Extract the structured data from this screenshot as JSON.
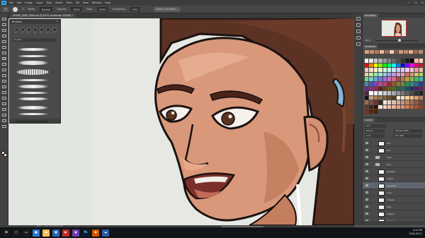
{
  "app": {
    "logo_text": "Ps",
    "menu": [
      "File",
      "Edit",
      "Image",
      "Layer",
      "Type",
      "Select",
      "Filter",
      "3D",
      "View",
      "Window",
      "Help"
    ],
    "window_controls": [
      "—",
      "☐",
      "✕"
    ]
  },
  "options": {
    "tool_preset": "B",
    "brush_size": "5",
    "mode_label": "Mode:",
    "mode_value": "Normal",
    "opacity_label": "Opacity:",
    "opacity_value": "100%",
    "flow_label": "Flow:",
    "flow_value": "100%",
    "smoothing_label": "Smoothing:",
    "smoothing_value": "10%",
    "select_mask_btn": "Select and Mask..."
  },
  "document": {
    "tab_title": "ZHURE_SHAE_SKIN.psd @ 200% (eyebrows, RGB/8) *"
  },
  "brushes_panel": {
    "title": "Brushes",
    "close": "»",
    "search_placeholder": "Brushes",
    "preset_sizes": [
      "10",
      "20",
      "30",
      "40",
      "50",
      "60",
      "70"
    ]
  },
  "navigator": {
    "tab": "Navigator",
    "zoom": "200%"
  },
  "swatches": {
    "tab": "Swatches",
    "recent": [
      "#d9a37f",
      "#c98e6b",
      "#b77a59",
      "#e8bfa0",
      "#a26b50",
      "#f0d2bb",
      "#8e5a43",
      "#d39b77",
      "#bf8866",
      "#e3b191",
      "#9e6a52",
      "#c58c6b"
    ],
    "palette": [
      "#ffffff",
      "#e6e6e6",
      "#cccccc",
      "#b3b3b3",
      "#999999",
      "#808080",
      "#666666",
      "#4d4d4d",
      "#333333",
      "#1a1a1a",
      "#000000",
      "#ffb3b3",
      "#ffd9b3",
      "#ff0000",
      "#ff8000",
      "#ffff00",
      "#80ff00",
      "#00ff00",
      "#00ff80",
      "#00ffff",
      "#0080ff",
      "#0000ff",
      "#8000ff",
      "#ff00ff",
      "#ff0080",
      "#c02020",
      "#f7c7c7",
      "#f7dbc7",
      "#f7f0c7",
      "#dcf7c7",
      "#c7f7d7",
      "#c7f7f0",
      "#c7e2f7",
      "#c7cdf7",
      "#dcc7f7",
      "#f7c7ed",
      "#f7c7d6",
      "#e89b9b",
      "#e8bd9b",
      "#e8d59b",
      "#c6e89b",
      "#9be8b3",
      "#9be8dc",
      "#9bc6e8",
      "#9ba6e8",
      "#c19be8",
      "#e89bd5",
      "#e89bb3",
      "#d66a6a",
      "#d6996a",
      "#d6bf6a",
      "#a9d66a",
      "#6ad68d",
      "#6ad6c4",
      "#6aa9d6",
      "#6a7bd6",
      "#a36ad6",
      "#d66abf",
      "#d66a8d",
      "#b84444",
      "#b87844",
      "#b8a044",
      "#88b844",
      "#44b86b",
      "#44b8a4",
      "#4488b8",
      "#4455b8",
      "#8444b8",
      "#b844a0",
      "#b8446b",
      "#8e2e2e",
      "#8e5a2e",
      "#8e7a2e",
      "#668e2e",
      "#2e8e4e",
      "#2e8e7e",
      "#2e668e",
      "#2e3b8e",
      "#642e8e",
      "#8e2e7a",
      "#8e2e4e",
      "#6a1e1e",
      "#6a421e",
      "#6a5a1e",
      "#4b6a1e",
      "#1e6a39",
      "#1e6a5e",
      "#1e4b6a",
      "#1e2b6a",
      "#4a1e6a",
      "#6a1e5a",
      "#6a1e39",
      "#ffffff",
      "#f2f2f2",
      "#e0e0e0",
      "#d0d0d0",
      "#c0c0c0",
      "#a8a8a8",
      "#909090",
      "#787878",
      "#606060",
      "#484848",
      "#303030",
      "#202020",
      "#101010",
      "#c8a080",
      "#b08060",
      "#987050",
      "#806040",
      "#685030",
      "#504020",
      "#fff0e0",
      "#ffe0c0",
      "#ffd0a0",
      "#ffc080",
      "#e0a070",
      "#c08060",
      "#a06850",
      "#805040",
      "#603830",
      "#402820",
      "#f0e6dc",
      "#e6d2c3",
      "#dcbfaa",
      "#d2ab91",
      "#c89878",
      "#be855f",
      "#a67050",
      "#8e5c42",
      "#764834",
      "#5e3526",
      "#462318",
      "#2e120a",
      "#ffe4d6",
      "#fbd3c0",
      "#f6c2aa",
      "#f1b194",
      "#eca07e",
      "#e78f68",
      "#d8794f",
      "#c0663f",
      "#a85431",
      "#904224",
      "#783218",
      "#60220d",
      "#482205"
    ]
  },
  "layers": {
    "tab": "Layers",
    "kind_label": "Kind",
    "blend_mode": "Normal",
    "opacity_label": "Opacity:",
    "opacity_value": "100%",
    "fill_label": "Fill:",
    "fill_value": "100%",
    "lock_label": "Lock:",
    "rows": [
      {
        "name": "hair",
        "type": "layer",
        "selected": false
      },
      {
        "name": "skin",
        "type": "layer",
        "selected": false
      },
      {
        "name": "lines",
        "type": "folder",
        "selected": false
      },
      {
        "name": "Face",
        "type": "folder",
        "selected": false
      },
      {
        "name": "shadows",
        "type": "layer",
        "selected": false
      },
      {
        "name": "mouth",
        "type": "layer",
        "selected": false
      },
      {
        "name": "eyebrows",
        "type": "layer",
        "selected": true
      },
      {
        "name": "nose",
        "type": "layer",
        "selected": false
      },
      {
        "name": "Smears",
        "type": "layer",
        "selected": false
      },
      {
        "name": "flats",
        "type": "layer",
        "selected": false
      },
      {
        "name": "Sudden",
        "type": "layer",
        "selected": false
      },
      {
        "name": "Layer 1",
        "type": "layer",
        "selected": false
      }
    ]
  },
  "status": {
    "zoom_text": "200%",
    "doc_text": "Doc: 38.3M/380.4M"
  },
  "taskbar": {
    "time": "4:24 PM",
    "date": "2018-08-11",
    "apps": [
      {
        "icon": "windows-logo-icon",
        "color": "#1b1b1b",
        "glyph": "⊞"
      },
      {
        "icon": "search-icon",
        "color": "#1b1b1b",
        "glyph": "○"
      },
      {
        "icon": "task-view-icon",
        "color": "#1b1b1b",
        "glyph": "▭"
      },
      {
        "icon": "chrome-icon",
        "color": "#2a7ad8",
        "glyph": "●"
      },
      {
        "icon": "folder-icon",
        "color": "#f2c14e",
        "glyph": "▬"
      },
      {
        "icon": "store-icon",
        "color": "#2b66b5",
        "glyph": "▣"
      },
      {
        "icon": "app-red-icon",
        "color": "#c62828",
        "glyph": "▶"
      },
      {
        "icon": "app-purple-icon",
        "color": "#6a3fb1",
        "glyph": "◆"
      },
      {
        "icon": "photoshop-icon",
        "color": "#001e36",
        "glyph": "Ps"
      },
      {
        "icon": "app-orange-icon",
        "color": "#d35400",
        "glyph": "◉"
      },
      {
        "icon": "app-blue-icon",
        "color": "#2d5aa5",
        "glyph": "☁"
      }
    ]
  }
}
